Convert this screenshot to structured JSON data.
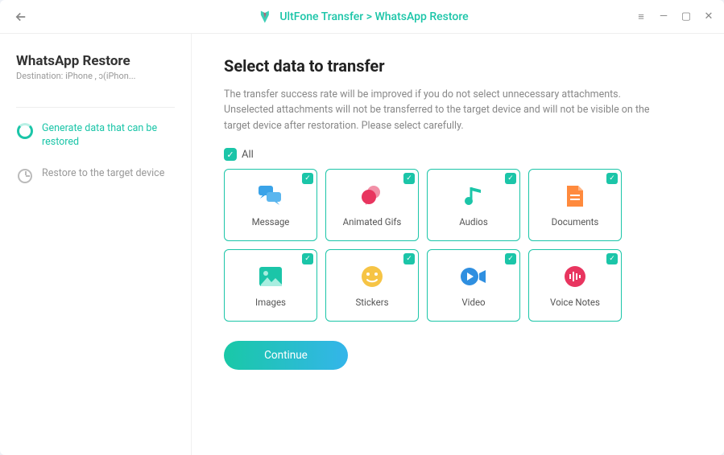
{
  "titlebar": {
    "breadcrumb": "UltFone Transfer > WhatsApp Restore"
  },
  "sidebar": {
    "title": "WhatsApp Restore",
    "subtitle": "Destination: iPhone    , ɔ(iPhon...",
    "steps": [
      {
        "label": "Generate data that can be restored",
        "active": true
      },
      {
        "label": "Restore to the target device",
        "active": false
      }
    ]
  },
  "main": {
    "title": "Select data to transfer",
    "description": "The transfer success rate will be improved if you do not select unnecessary attachments. Unselected attachments will not be transferred to the target device and will not be visible on the target device after restoration. Please select carefully.",
    "all_label": "All",
    "cards": [
      {
        "label": "Message"
      },
      {
        "label": "Animated Gifs"
      },
      {
        "label": "Audios"
      },
      {
        "label": "Documents"
      },
      {
        "label": "Images"
      },
      {
        "label": "Stickers"
      },
      {
        "label": "Video"
      },
      {
        "label": "Voice Notes"
      }
    ],
    "continue_label": "Continue"
  },
  "icons": {
    "message_color": "#3aa3e8",
    "gifs_color": "#e8355f",
    "audios_color": "#1bc5a8",
    "docs_color": "#ff8a3d",
    "images_color": "#1bc5a8",
    "stickers_color": "#f6c445",
    "video_color": "#2f8fe0",
    "voice_color": "#e8355f"
  }
}
